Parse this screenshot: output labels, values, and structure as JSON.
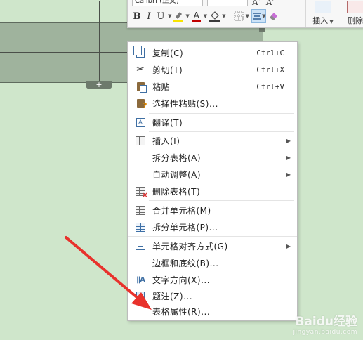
{
  "toolbar": {
    "font_name": "Calibri (正文)",
    "bold_label": "B",
    "italic_label": "I",
    "underline_label": "U",
    "font_color_label": "A",
    "insert_label": "插入",
    "delete_label": "删除"
  },
  "context_menu": {
    "items": [
      {
        "label": "复制(C)",
        "shortcut": "Ctrl+C",
        "icon": "copy-icon"
      },
      {
        "label": "剪切(T)",
        "shortcut": "Ctrl+X",
        "icon": "scissors-icon"
      },
      {
        "label": "粘贴",
        "shortcut": "Ctrl+V",
        "icon": "paste-icon"
      },
      {
        "label": "选择性粘贴(S)...",
        "icon": "paste-special-icon"
      },
      {
        "label": "翻译(T)",
        "icon": "translate-icon"
      },
      {
        "label": "插入(I)",
        "icon": "table-insert-icon",
        "submenu": true
      },
      {
        "label": "拆分表格(A)",
        "submenu": true
      },
      {
        "label": "自动调整(A)",
        "submenu": true
      },
      {
        "label": "删除表格(T)",
        "icon": "delete-table-icon"
      },
      {
        "label": "合并单元格(M)",
        "icon": "merge-cells-icon"
      },
      {
        "label": "拆分单元格(P)...",
        "icon": "split-cells-icon"
      },
      {
        "label": "单元格对齐方式(G)",
        "icon": "cell-align-icon",
        "submenu": true
      },
      {
        "label": "边框和底纹(B)..."
      },
      {
        "label": "文字方向(X)...",
        "icon": "text-direction-icon"
      },
      {
        "label": "题注(Z)...",
        "icon": "caption-icon"
      },
      {
        "label": "表格属性(R)..."
      }
    ]
  },
  "table": {
    "add_row_label": "+"
  },
  "watermark": {
    "text": "Baidu经验",
    "sub": "jingyan.baidu.com"
  },
  "colors": {
    "background": "#cfe6cb",
    "table_fill": "#9fb39d",
    "arrow": "#e8322c",
    "highlight_yellow": "#f7e300",
    "font_red": "#c00000"
  }
}
